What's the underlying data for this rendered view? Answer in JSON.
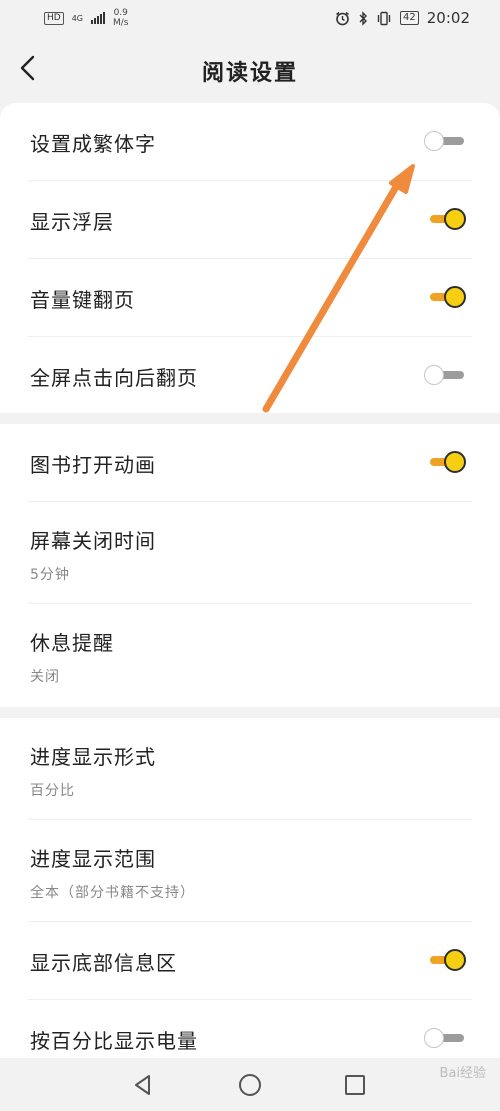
{
  "status_bar": {
    "hd": "HD",
    "network": "4G",
    "speed_value": "0.9",
    "speed_unit": "M/s",
    "battery": "42",
    "time": "20:02"
  },
  "header": {
    "title": "阅读设置",
    "back_icon": "chevron-left-icon"
  },
  "groups": [
    {
      "items": [
        {
          "label": "设置成繁体字",
          "toggle": false
        },
        {
          "label": "显示浮层",
          "toggle": true
        },
        {
          "label": "音量键翻页",
          "toggle": true
        },
        {
          "label": "全屏点击向后翻页",
          "toggle": false
        }
      ]
    },
    {
      "items": [
        {
          "label": "图书打开动画",
          "toggle": true
        },
        {
          "label": "屏幕关闭时间",
          "value": "5分钟"
        },
        {
          "label": "休息提醒",
          "value": "关闭"
        }
      ]
    },
    {
      "items": [
        {
          "label": "进度显示形式",
          "value": "百分比"
        },
        {
          "label": "进度显示范围",
          "value": "全本（部分书籍不支持）"
        },
        {
          "label": "显示底部信息区",
          "toggle": true
        },
        {
          "label": "按百分比显示电量",
          "toggle": false
        }
      ]
    }
  ],
  "colors": {
    "toggle_on_track": "#f0a323",
    "toggle_on_knob": "#f7cf12",
    "toggle_off_track": "#9c9c9c",
    "annotation_arrow": "#f08a3c"
  },
  "nav_bar": {
    "icons": [
      "back-triangle-icon",
      "home-circle-icon",
      "recents-square-icon"
    ]
  },
  "watermark": "Bai经验"
}
